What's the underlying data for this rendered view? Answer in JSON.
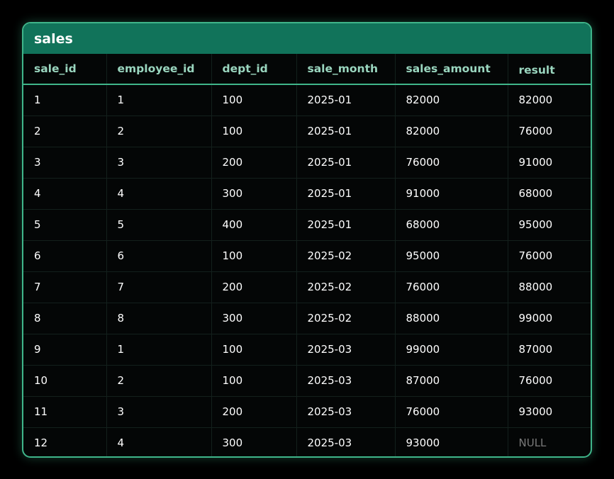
{
  "table": {
    "name": "sales",
    "columns": [
      "sale_id",
      "employee_id",
      "dept_id",
      "sale_month",
      "sales_amount",
      "result"
    ],
    "rows": [
      [
        "1",
        "1",
        "100",
        "2025-01",
        "82000",
        "82000"
      ],
      [
        "2",
        "2",
        "100",
        "2025-01",
        "82000",
        "76000"
      ],
      [
        "3",
        "3",
        "200",
        "2025-01",
        "76000",
        "91000"
      ],
      [
        "4",
        "4",
        "300",
        "2025-01",
        "91000",
        "68000"
      ],
      [
        "5",
        "5",
        "400",
        "2025-01",
        "68000",
        "95000"
      ],
      [
        "6",
        "6",
        "100",
        "2025-02",
        "95000",
        "76000"
      ],
      [
        "7",
        "7",
        "200",
        "2025-02",
        "76000",
        "88000"
      ],
      [
        "8",
        "8",
        "300",
        "2025-02",
        "88000",
        "99000"
      ],
      [
        "9",
        "1",
        "100",
        "2025-03",
        "99000",
        "87000"
      ],
      [
        "10",
        "2",
        "100",
        "2025-03",
        "87000",
        "76000"
      ],
      [
        "11",
        "3",
        "200",
        "2025-03",
        "76000",
        "93000"
      ],
      [
        "12",
        "4",
        "300",
        "2025-03",
        "93000",
        "NULL"
      ]
    ]
  },
  "colors": {
    "background": "#000000",
    "border": "#3fb58a",
    "title_bar": "#11735a",
    "header_text": "#9ad6bf",
    "cell_text": "#ffffff",
    "null_text": "#7a7a7a"
  }
}
